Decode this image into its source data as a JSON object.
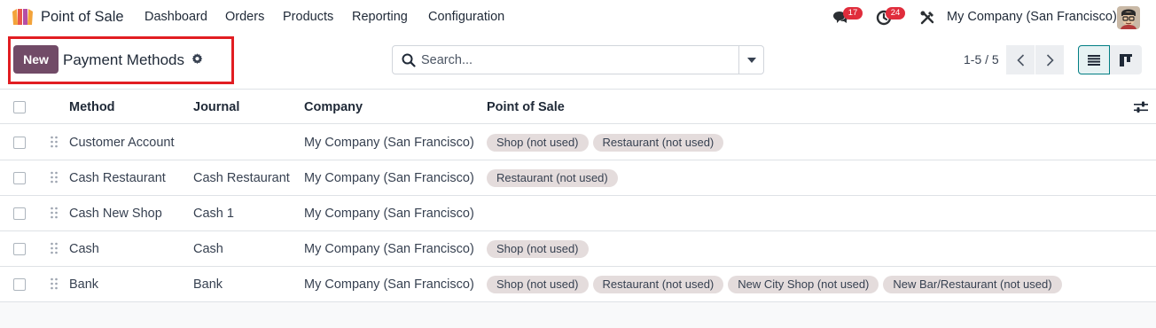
{
  "app": {
    "name": "Point of Sale"
  },
  "menu": [
    "Dashboard",
    "Orders",
    "Products",
    "Reporting",
    "Configuration"
  ],
  "systray": {
    "messages_count": "17",
    "activities_count": "24",
    "company": "My Company (San Francisco)"
  },
  "control_panel": {
    "new_label": "New",
    "title": "Payment Methods",
    "search_placeholder": "Search...",
    "pager": "1-5 / 5"
  },
  "table": {
    "columns": [
      "Method",
      "Journal",
      "Company",
      "Point of Sale"
    ],
    "rows": [
      {
        "method": "Customer Account",
        "journal": "",
        "company": "My Company (San Francisco)",
        "pos": [
          "Shop (not used)",
          "Restaurant (not used)"
        ]
      },
      {
        "method": "Cash Restaurant",
        "journal": "Cash Restaurant",
        "company": "My Company (San Francisco)",
        "pos": [
          "Restaurant (not used)"
        ]
      },
      {
        "method": "Cash New Shop",
        "journal": "Cash 1",
        "company": "My Company (San Francisco)",
        "pos": []
      },
      {
        "method": "Cash",
        "journal": "Cash",
        "company": "My Company (San Francisco)",
        "pos": [
          "Shop (not used)"
        ]
      },
      {
        "method": "Bank",
        "journal": "Bank",
        "company": "My Company (San Francisco)",
        "pos": [
          "Shop (not used)",
          "Restaurant (not used)",
          "New City Shop (not used)",
          "New Bar/Restaurant (not used)"
        ]
      }
    ]
  },
  "colors": {
    "brand": "#714b67",
    "badge": "#e02d3c",
    "tag_bg": "#e4dcdc",
    "highlight": "#e11d22"
  }
}
